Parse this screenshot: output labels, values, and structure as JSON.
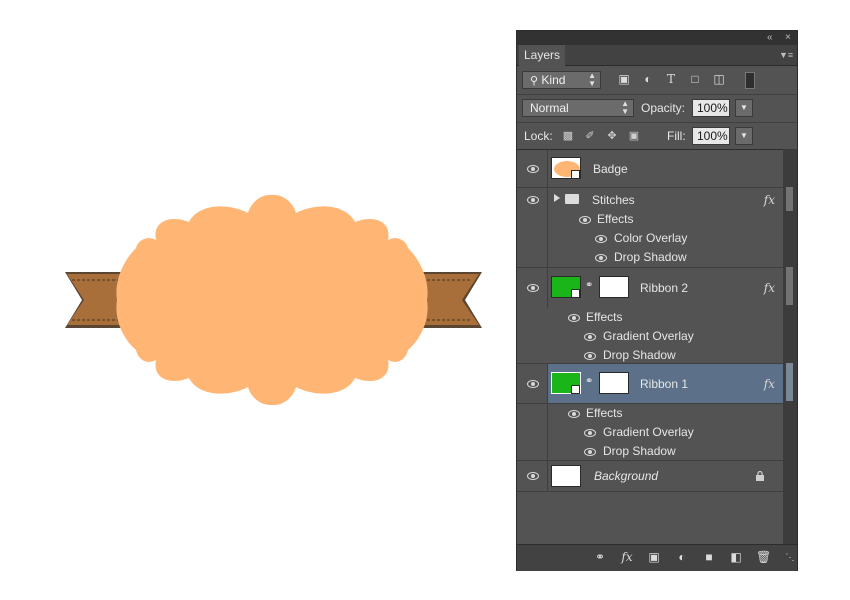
{
  "canvas": {
    "badge_color": "#ffb574",
    "ribbon_color": "#a86f3a",
    "ribbon_shadow": "#5b4634"
  },
  "panel": {
    "tab_label": "Layers",
    "filter": {
      "label": "Kind",
      "icons": [
        "image-filter-icon",
        "adjustment-filter-icon",
        "type-filter-icon",
        "shape-filter-icon",
        "smart-object-filter-icon",
        "filter-toggle-icon"
      ]
    },
    "blend_mode": "Normal",
    "opacity_label": "Opacity:",
    "opacity_value": "100%",
    "lock_label": "Lock:",
    "fill_label": "Fill:",
    "fill_value": "100%",
    "layers": [
      {
        "name": "Badge",
        "type": "shape"
      },
      {
        "name": "Stitches",
        "type": "group",
        "fx": "fx",
        "effects_label": "Effects",
        "effects": [
          "Color Overlay",
          "Drop Shadow"
        ]
      },
      {
        "name": "Ribbon 2",
        "type": "shape",
        "fx": "fx",
        "effects_label": "Effects",
        "effects": [
          "Gradient Overlay",
          "Drop Shadow"
        ]
      },
      {
        "name": "Ribbon 1",
        "type": "shape",
        "fx": "fx",
        "selected": true,
        "effects_label": "Effects",
        "effects": [
          "Gradient Overlay",
          "Drop Shadow"
        ]
      },
      {
        "name": "Background",
        "type": "background",
        "locked": true
      }
    ],
    "footer_icons": [
      "link-layers-icon",
      "fx-icon",
      "add-mask-icon",
      "adjustment-layer-icon",
      "new-group-icon",
      "new-layer-icon",
      "trash-icon"
    ],
    "fx_symbol": "fx"
  }
}
